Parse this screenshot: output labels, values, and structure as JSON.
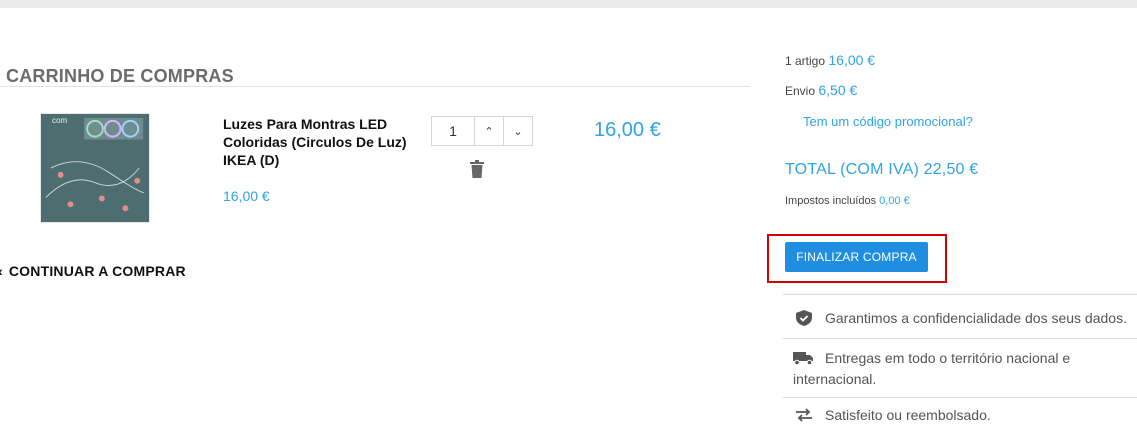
{
  "cart": {
    "title": "CARRINHO DE COMPRAS",
    "product": {
      "image_caption": "com",
      "name": "Luzes Para Montras LED Coloridas (Circulos De Luz) IKEA (D)",
      "unit_price": "16,00 €",
      "quantity": "1",
      "line_total": "16,00 €"
    },
    "continue_label": "CONTINUAR A COMPRAR"
  },
  "summary": {
    "items_label": "1 artigo",
    "items_value": "16,00 €",
    "shipping_label": "Envio",
    "shipping_value": "6,50 €",
    "promo_link": "Tem um código promocional?",
    "total": "TOTAL (COM IVA) 22,50 €",
    "taxes_label": "Impostos incluídos",
    "taxes_value": "0,00 €",
    "checkout_label": "FINALIZAR COMPRA"
  },
  "assurances": [
    {
      "icon": "shield-check-icon",
      "text": "Garantimos a confidencialidade dos seus dados."
    },
    {
      "icon": "truck-icon",
      "text": "Entregas em todo o território nacional e internacional."
    },
    {
      "icon": "exchange-arrows-icon",
      "text": "Satisfeito ou reembolsado."
    }
  ],
  "colors": {
    "accent": "#2fa4e7",
    "button": "#1f8de0",
    "highlight_frame": "#d40000",
    "heading": "#6b6b6b"
  }
}
